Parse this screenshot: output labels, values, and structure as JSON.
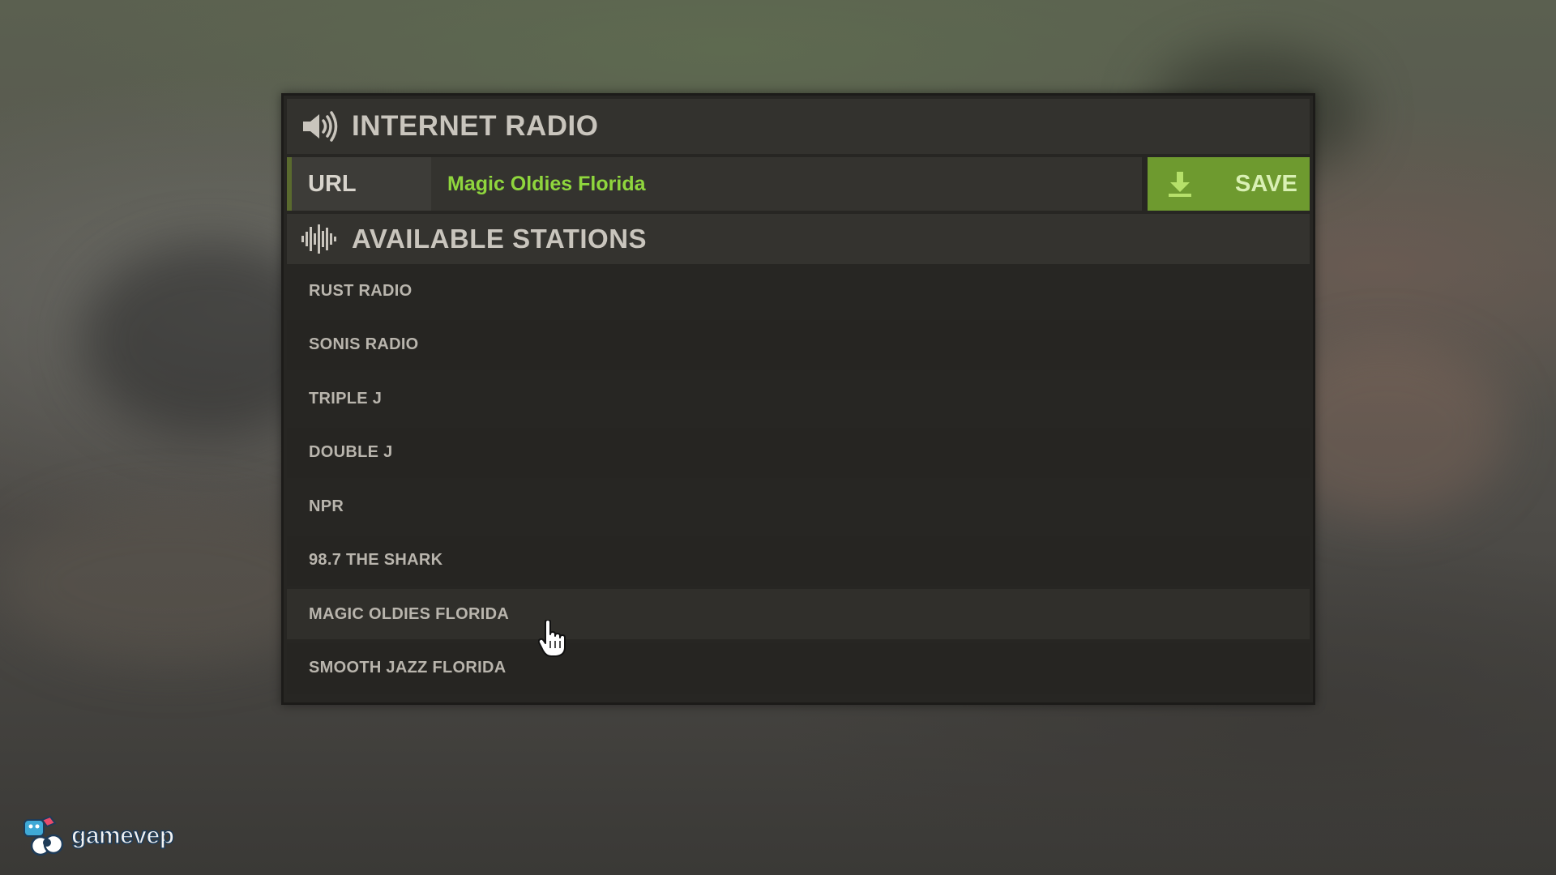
{
  "panel": {
    "title": "INTERNET RADIO",
    "title_icon": "speaker-icon"
  },
  "url_bar": {
    "label": "URL",
    "value": "Magic Oldies Florida",
    "save_label": "SAVE",
    "save_icon": "download-icon"
  },
  "stations": {
    "title": "AVAILABLE STATIONS",
    "title_icon": "waveform-icon",
    "items": [
      {
        "label": "RUST RADIO"
      },
      {
        "label": "SONIS RADIO"
      },
      {
        "label": "TRIPLE J"
      },
      {
        "label": "DOUBLE J"
      },
      {
        "label": "NPR"
      },
      {
        "label": "98.7 THE SHARK"
      },
      {
        "label": "MAGIC OLDIES FLORIDA"
      },
      {
        "label": "SMOOTH JAZZ FLORIDA"
      }
    ],
    "hovered_index": 6
  },
  "watermark": {
    "text": "gamevep",
    "icon": "gamevep-logo-icon"
  },
  "colors": {
    "accent_green": "#6e9a2f",
    "url_text_green": "#8fd63d",
    "panel_bg": "#272623"
  }
}
